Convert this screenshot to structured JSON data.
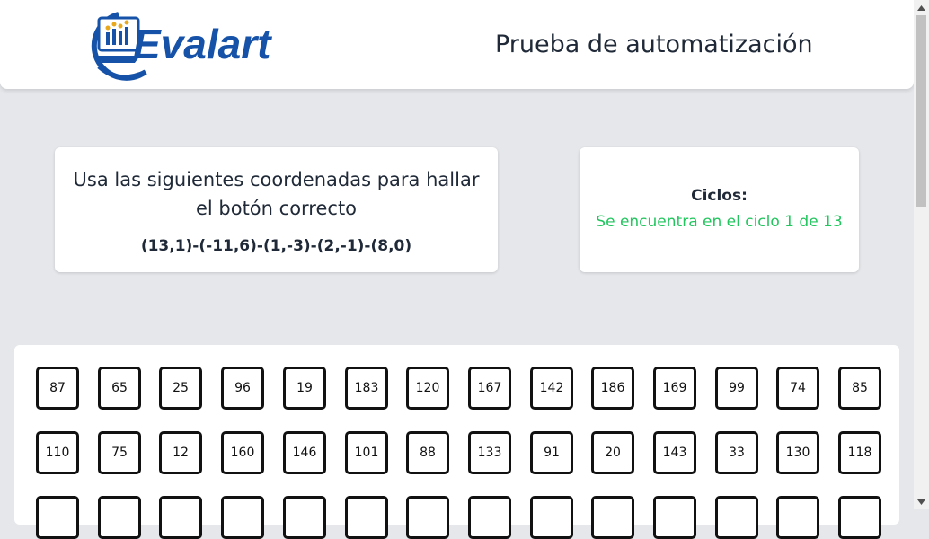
{
  "header": {
    "logo_text": "Evalart",
    "title": "Prueba de automatización"
  },
  "instructions": {
    "text": "Usa las siguientes coordenadas para hallar el botón correcto",
    "coordinates": "(13,1)-(-11,6)-(1,-3)-(2,-1)-(8,0)"
  },
  "cycles": {
    "label": "Ciclos:",
    "status": "Se encuentra en el ciclo 1 de 13",
    "status_color": "#22c55e"
  },
  "grid": {
    "rows": [
      [
        "87",
        "65",
        "25",
        "96",
        "19",
        "183",
        "120",
        "167",
        "142",
        "186",
        "169",
        "99",
        "74",
        "85"
      ],
      [
        "110",
        "75",
        "12",
        "160",
        "146",
        "101",
        "88",
        "133",
        "91",
        "20",
        "143",
        "33",
        "130",
        "118"
      ],
      [
        "",
        "",
        "",
        "",
        "",
        "",
        "",
        "",
        "",
        "",
        "",
        "",
        "",
        ""
      ]
    ]
  },
  "scrollbar": {
    "up_icon": "triangle-up",
    "down_icon": "triangle-down"
  }
}
